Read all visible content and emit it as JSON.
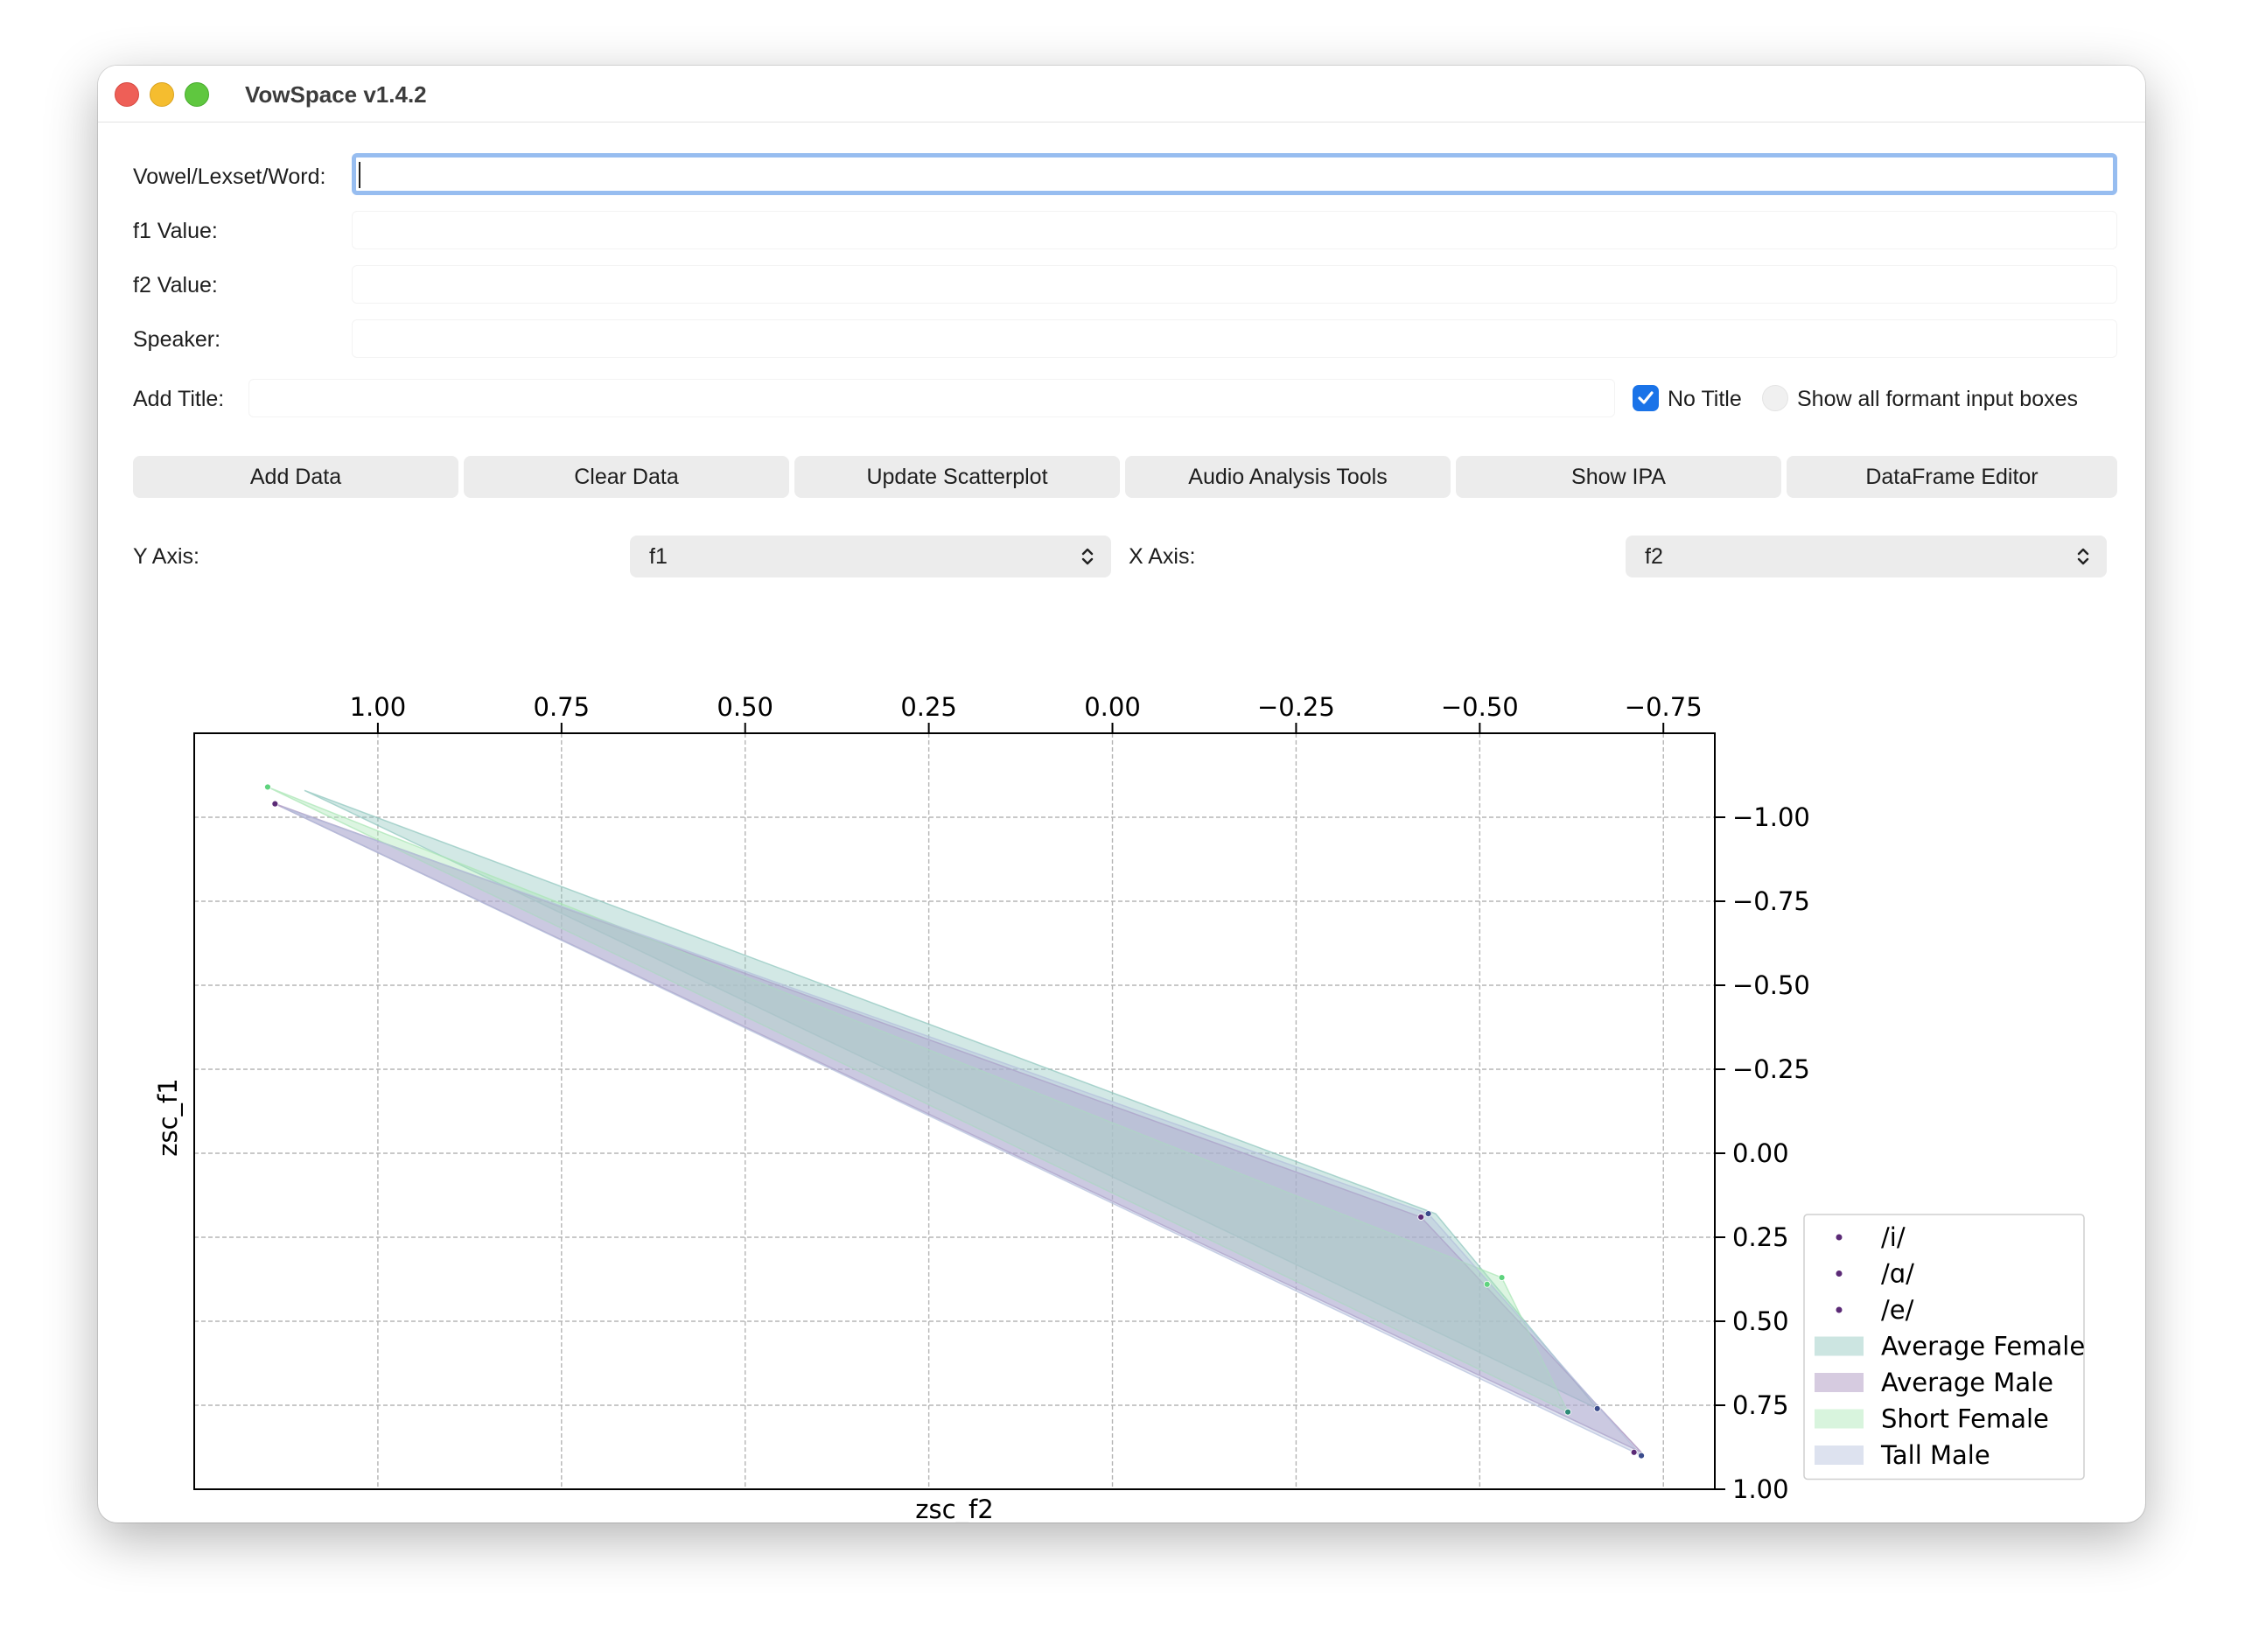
{
  "window": {
    "title": "VowSpace v1.4.2"
  },
  "form": {
    "vowel_label": "Vowel/Lexset/Word:",
    "vowel_value": "",
    "f1_label": "f1 Value:",
    "f2_label": "f2 Value:",
    "speaker_label": "Speaker:",
    "title_label": "Add Title:",
    "no_title_label": "No Title",
    "no_title_checked": true,
    "show_all_label": "Show all formant input boxes",
    "show_all_checked": false
  },
  "toolbar": {
    "buttons": [
      "Add Data",
      "Clear Data",
      "Update Scatterplot",
      "Audio Analysis Tools",
      "Show IPA",
      "DataFrame Editor"
    ]
  },
  "axes_select": {
    "y_label": "Y Axis:",
    "y_value": "f1",
    "x_label": "X Axis:",
    "x_value": "f2"
  },
  "chart_data": {
    "type": "scatter",
    "xlabel": "zsc_f2",
    "ylabel": "zsc_f1",
    "x_inverted": true,
    "y_inverted": true,
    "xlim": [
      1.25,
      -0.82
    ],
    "ylim": [
      -1.25,
      1.0
    ],
    "x_ticks": [
      "1.00",
      "0.75",
      "0.50",
      "0.25",
      "0.00",
      "−0.25",
      "−0.50",
      "−0.75"
    ],
    "y_ticks": [
      "−1.00",
      "−0.75",
      "−0.50",
      "−0.25",
      "0.00",
      "0.25",
      "0.50",
      "0.75",
      "1.00"
    ],
    "grid": true,
    "legend_position": "lower-right",
    "point_series": [
      {
        "name": "/i/",
        "color": "#5b2a76"
      },
      {
        "name": "/ɑ/",
        "color": "#5b2a76"
      },
      {
        "name": "/e/",
        "color": "#5b2a76"
      }
    ],
    "areas": [
      {
        "name": "Average Female",
        "color": "#8fc6bd",
        "points": [
          [
            1.1,
            -1.08
          ],
          [
            -0.66,
            0.76
          ],
          [
            -0.44,
            0.18
          ]
        ]
      },
      {
        "name": "Average Male",
        "color": "#a48bbb",
        "points": [
          [
            1.14,
            -1.04
          ],
          [
            -0.72,
            0.89
          ],
          [
            -0.42,
            0.19
          ]
        ]
      },
      {
        "name": "Short Female",
        "color": "#a8e6b4",
        "points": [
          [
            1.15,
            -1.09
          ],
          [
            -0.62,
            0.77
          ],
          [
            -0.53,
            0.37
          ]
        ]
      },
      {
        "name": "Tall Male",
        "color": "#b3bfdb",
        "points": [
          [
            1.13,
            -1.03
          ],
          [
            -0.72,
            0.9
          ],
          [
            -0.43,
            0.18
          ]
        ]
      }
    ],
    "points": [
      {
        "series": "/i/",
        "x": 1.15,
        "y": -1.09,
        "color": "#5fd37e"
      },
      {
        "series": "/i/",
        "x": 1.14,
        "y": -1.04,
        "color": "#5b2a76"
      },
      {
        "series": "/ɑ/",
        "x": -0.72,
        "y": 0.9,
        "color": "#3b4c8c"
      },
      {
        "series": "/ɑ/",
        "x": -0.71,
        "y": 0.89,
        "color": "#5b2a76"
      },
      {
        "series": "/ɑ/",
        "x": -0.66,
        "y": 0.76,
        "color": "#3b4c8c"
      },
      {
        "series": "/ɑ/",
        "x": -0.62,
        "y": 0.77,
        "color": "#2e8a78"
      },
      {
        "series": "/e/",
        "x": -0.42,
        "y": 0.19,
        "color": "#5b2a76"
      },
      {
        "series": "/e/",
        "x": -0.43,
        "y": 0.18,
        "color": "#3b4c8c"
      },
      {
        "series": "/e/",
        "x": -0.53,
        "y": 0.37,
        "color": "#5fd37e"
      },
      {
        "series": "/e/",
        "x": -0.51,
        "y": 0.39,
        "color": "#5fd37e"
      }
    ]
  }
}
